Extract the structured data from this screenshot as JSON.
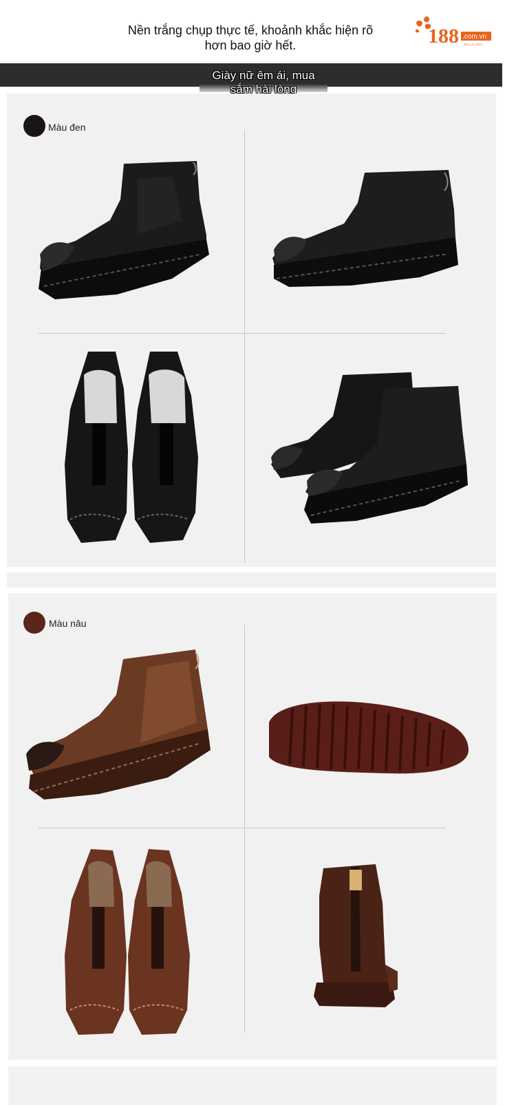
{
  "header": {
    "line1": "Nền trắng chụp thực tế, khoảnh khắc hiện rõ",
    "line2": "hơn bao giờ hết.",
    "logo": {
      "brand": "188",
      "domain": ".com.vn",
      "tagline": "BÁN LÀ THÍCH"
    }
  },
  "banner": {
    "line1": "Giày nữ êm ái, mua",
    "line2": "sắm hài lòng"
  },
  "sections": [
    {
      "color_label": "Màu đen",
      "swatch_color": "#1a1414"
    },
    {
      "color_label": "Màu nâu",
      "swatch_color": "#5a261c"
    }
  ],
  "colors": {
    "accent": "#e8641e",
    "banner_bg": "#2c2d2f",
    "panel_bg": "#f1f1f1"
  }
}
